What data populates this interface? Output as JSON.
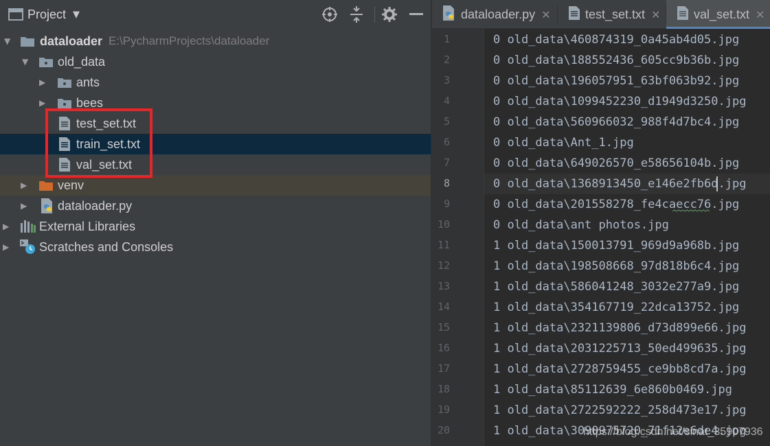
{
  "colors": {
    "panel_bg": "#3c3f41",
    "editor_bg": "#2b2b2b",
    "selection_bg": "#0d293e",
    "excluded_bg": "#45433a",
    "highlight_border": "#e8262a",
    "active_tab_underline": "#4a88c7",
    "folder_icon": "#8c9ba8",
    "venv_folder": "#d0692c"
  },
  "project_panel": {
    "title": "Project",
    "header_icons": [
      "chevron-down-icon",
      "locate-icon",
      "collapse-all-icon",
      "gear-icon",
      "hide-icon"
    ],
    "tree": [
      {
        "label": "dataloader",
        "path": "E:\\PycharmProjects\\dataloader",
        "icon": "folder-icon",
        "expanded": true
      },
      {
        "label": "old_data",
        "icon": "folder-icon",
        "expanded": true
      },
      {
        "label": "ants",
        "icon": "folder-icon",
        "expanded": false
      },
      {
        "label": "bees",
        "icon": "folder-icon",
        "expanded": false
      },
      {
        "label": "test_set.txt",
        "icon": "text-file-icon"
      },
      {
        "label": "train_set.txt",
        "icon": "text-file-icon",
        "selected": true
      },
      {
        "label": "val_set.txt",
        "icon": "text-file-icon"
      },
      {
        "label": "venv",
        "icon": "excluded-folder-icon",
        "expanded": false
      },
      {
        "label": "dataloader.py",
        "icon": "python-file-icon",
        "expanded": false
      },
      {
        "label": "External Libraries",
        "icon": "libraries-icon",
        "expanded": false
      },
      {
        "label": "Scratches and Consoles",
        "icon": "scratches-icon",
        "expanded": false
      }
    ]
  },
  "editor": {
    "tabs": [
      {
        "label": "dataloader.py",
        "icon": "python-file-icon",
        "active": false
      },
      {
        "label": "test_set.txt",
        "icon": "text-file-icon",
        "active": false
      },
      {
        "label": "val_set.txt",
        "icon": "text-file-icon",
        "active": true
      }
    ],
    "close_glyph": "✕",
    "current_line": 8,
    "lines": [
      {
        "n": "1",
        "text": "0 old_data\\460874319_0a45ab4d05.jpg"
      },
      {
        "n": "2",
        "text": "0 old_data\\188552436_605cc9b36b.jpg"
      },
      {
        "n": "3",
        "text": "0 old_data\\196057951_63bf063b92.jpg"
      },
      {
        "n": "4",
        "text": "0 old_data\\1099452230_d1949d3250.jpg"
      },
      {
        "n": "5",
        "text": "0 old_data\\560966032_988f4d7bc4.jpg"
      },
      {
        "n": "6",
        "text": "0 old_data\\Ant_1.jpg"
      },
      {
        "n": "7",
        "text": "0 old_data\\649026570_e58656104b.jpg"
      },
      {
        "n": "8",
        "text": "0 old_data\\1368913450_e146e2fb6d.jpg"
      },
      {
        "n": "9",
        "text": "0 old_data\\201558278_fe4caecc76.jpg"
      },
      {
        "n": "10",
        "text": "0 old_data\\ant photos.jpg"
      },
      {
        "n": "11",
        "text": "1 old_data\\150013791_969d9a968b.jpg"
      },
      {
        "n": "12",
        "text": "1 old_data\\198508668_97d818b6c4.jpg"
      },
      {
        "n": "13",
        "text": "1 old_data\\586041248_3032e277a9.jpg"
      },
      {
        "n": "14",
        "text": "1 old_data\\354167719_22dca13752.jpg"
      },
      {
        "n": "15",
        "text": "1 old_data\\2321139806_d73d899e66.jpg"
      },
      {
        "n": "16",
        "text": "1 old_data\\2031225713_50ed499635.jpg"
      },
      {
        "n": "17",
        "text": "1 old_data\\2728759455_ce9bb8cd7a.jpg"
      },
      {
        "n": "18",
        "text": "1 old_data\\85112639_6e860b0469.jpg"
      },
      {
        "n": "19",
        "text": "1 old_data\\2722592222_258d473e17.jpg"
      },
      {
        "n": "20",
        "text": "1 old_data\\3090975720_71f12e6de4.jpg"
      }
    ]
  },
  "watermark": "https://blog.csdn.net/sinat_35907936"
}
